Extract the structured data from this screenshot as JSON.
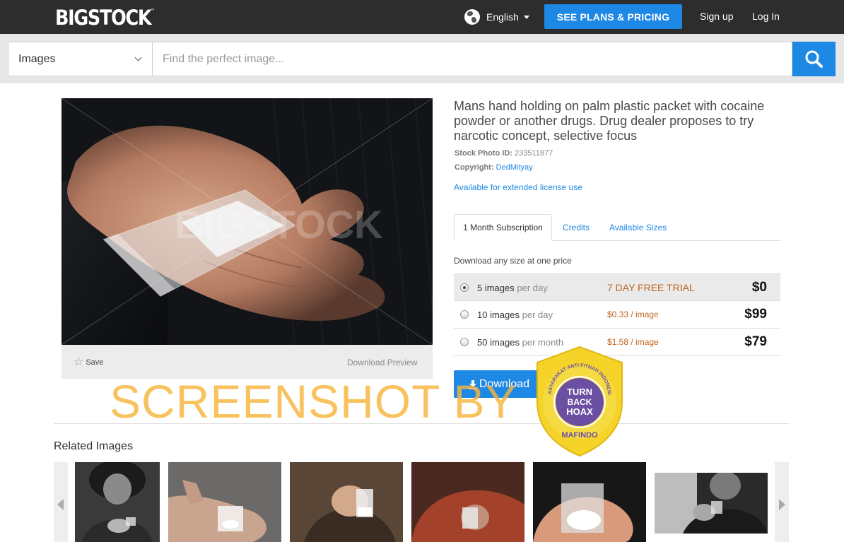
{
  "header": {
    "logo_text": "BIGSTOCK",
    "logo_tm": "™",
    "language": "English",
    "plans_button": "SEE PLANS & PRICING",
    "sign_up": "Sign up",
    "log_in": "Log In"
  },
  "search": {
    "category": "Images",
    "placeholder": "Find the perfect image..."
  },
  "image": {
    "photo_watermark": "BIGSTOCK",
    "save_label": "Save",
    "download_preview": "Download Preview",
    "title": "Mans hand holding on palm plastic packet with cocaine powder or another drugs. Drug dealer proposes to try narcotic concept, selective focus",
    "stock_id_label": "Stock Photo ID:",
    "stock_id": "233511877",
    "copyright_label": "Copyright:",
    "copyright_holder": "DedMityay",
    "extended_license": "Available for extended license use"
  },
  "tabs": [
    "1 Month Subscription",
    "Credits",
    "Available Sizes"
  ],
  "pricing": {
    "intro": "Download any size at one price",
    "rows": [
      {
        "qty": "5 images",
        "per": "per day",
        "offer": "7 DAY FREE TRIAL",
        "price": "$0",
        "selected": true
      },
      {
        "qty": "10 images",
        "per": "per day",
        "offer": "$0.33 / image",
        "price": "$99",
        "selected": false
      },
      {
        "qty": "50 images",
        "per": "per month",
        "offer": "$1.58 / image",
        "price": "$79",
        "selected": false
      }
    ],
    "download_button": "Download"
  },
  "related": {
    "title": "Related Images"
  },
  "overlay": {
    "screenshot_watermark": "SCREENSHOT BY",
    "badge_line1": "TURN",
    "badge_line2": "BACK",
    "badge_line3": "HOAX",
    "badge_ring_text": "MASYARAKAT ANTI FITNAH INDONESIA",
    "badge_bottom": "MAFINDO"
  },
  "colors": {
    "topbar": "#2d2d2d",
    "accent": "#1e88e5",
    "offer": "#c0651e",
    "watermark": "#f7b43c",
    "badge_gold": "#f5d329",
    "badge_purple": "#6a4fa3"
  }
}
